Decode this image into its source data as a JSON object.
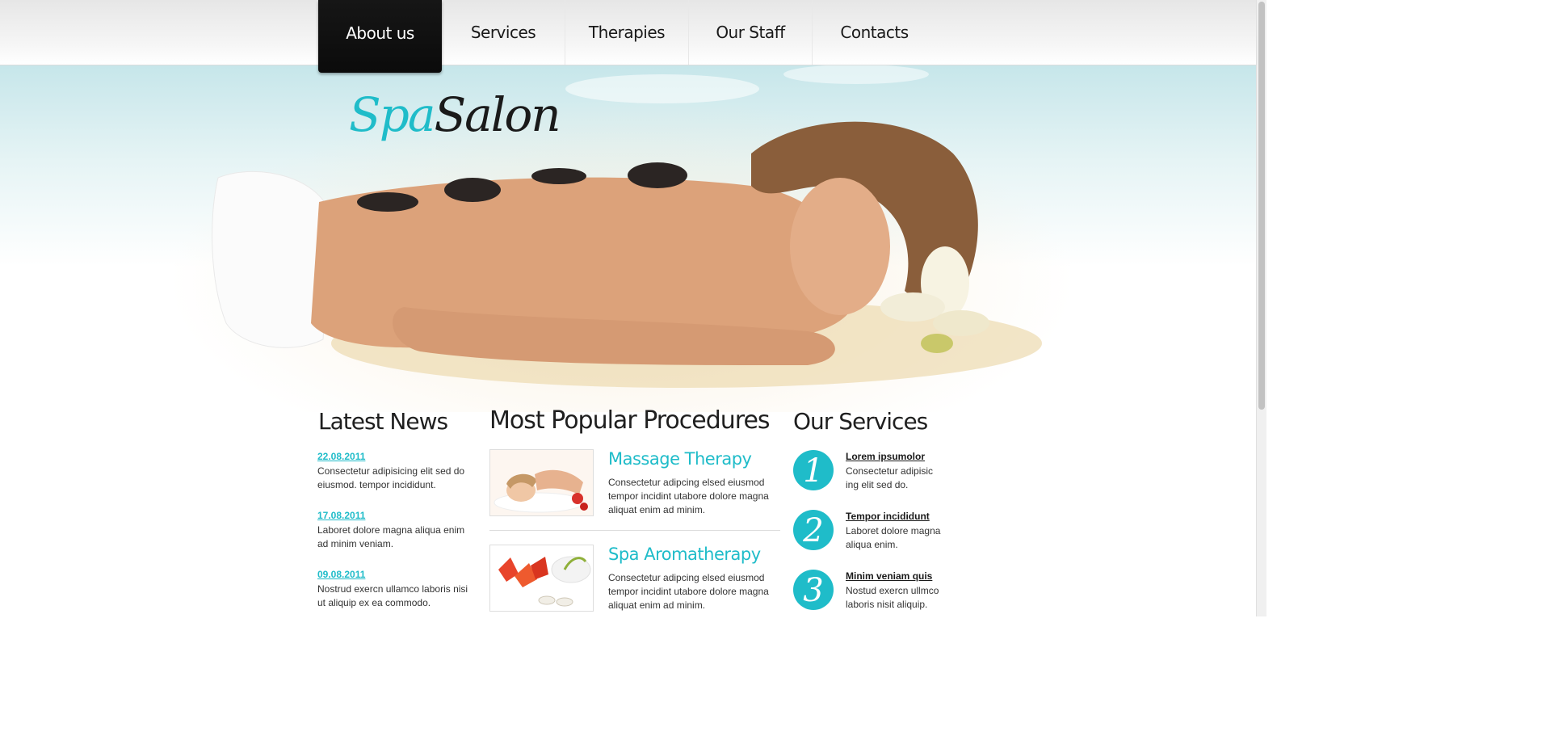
{
  "nav": {
    "items": [
      {
        "label": "About us",
        "active": true
      },
      {
        "label": "Services",
        "active": false
      },
      {
        "label": "Therapies",
        "active": false
      },
      {
        "label": "Our Staff",
        "active": false
      },
      {
        "label": "Contacts",
        "active": false
      }
    ]
  },
  "logo": {
    "spa": "Spa",
    "salon": "Salon"
  },
  "news": {
    "heading": "Latest News",
    "items": [
      {
        "date": "22.08.2011",
        "text": "Consectetur adipisicing elit sed do eiusmod. tempor incididunt."
      },
      {
        "date": "17.08.2011",
        "text": "Laboret dolore magna aliqua enim ad minim veniam."
      },
      {
        "date": "09.08.2011",
        "text": "Nostrud exercn ullamco laboris nisi ut aliquip ex ea commodo."
      }
    ]
  },
  "procedures": {
    "heading": "Most Popular Procedures",
    "items": [
      {
        "title": "Massage Therapy",
        "text": "Consectetur adipcing elsed eiusmod tempor incidint utabore dolore magna aliquat enim ad minim."
      },
      {
        "title": "Spa Aromatherapy",
        "text": "Consectetur adipcing elsed eiusmod tempor incidint utabore dolore magna aliquat enim ad minim."
      }
    ]
  },
  "services": {
    "heading": "Our Services",
    "items": [
      {
        "number": "1",
        "title": "Lorem ipsumolor",
        "text": "Consectetur adipisic ing elit sed do."
      },
      {
        "number": "2",
        "title": "Tempor incididunt",
        "text": "Laboret dolore magna aliqua enim."
      },
      {
        "number": "3",
        "title": "Minim veniam quis",
        "text": "Nostud exercn ullmco laboris nisit aliquip."
      }
    ]
  },
  "colors": {
    "accent": "#1fbcc9",
    "nav_active_bg": "#111111",
    "text": "#333333"
  }
}
